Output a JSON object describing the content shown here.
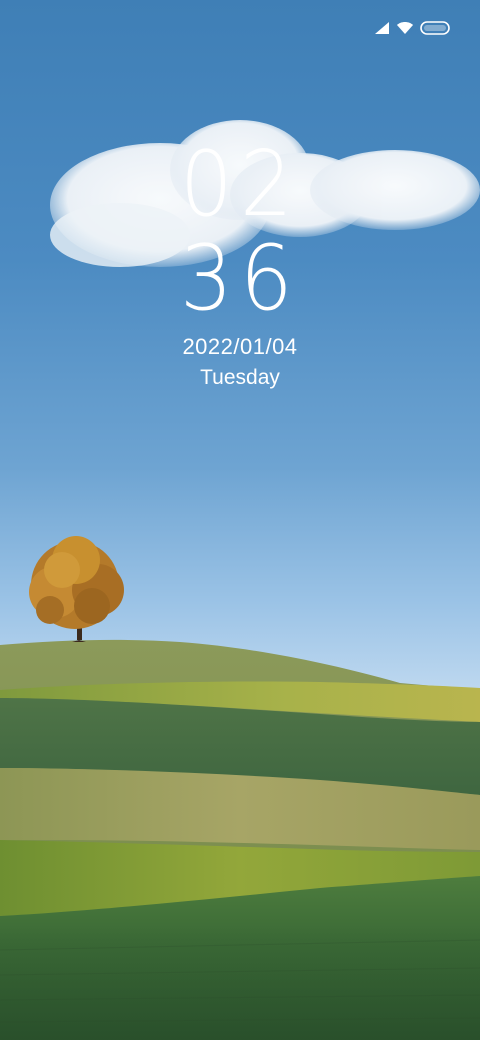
{
  "status_bar": {
    "icons": [
      "signal-icon",
      "wifi-icon",
      "battery-icon"
    ]
  },
  "lock_screen": {
    "hours": "02",
    "minutes": "36",
    "date": "2022/01/04",
    "day": "Tuesday"
  }
}
